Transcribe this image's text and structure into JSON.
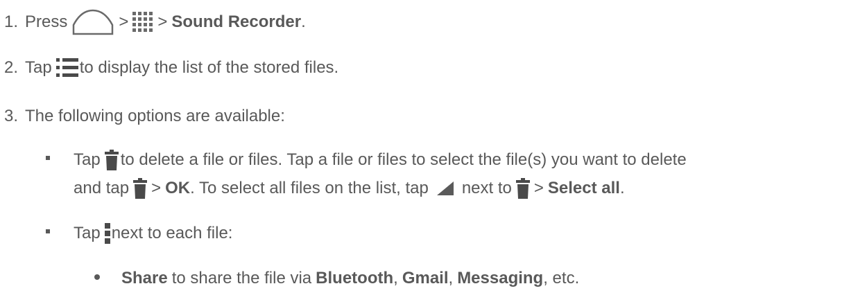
{
  "steps": [
    {
      "number": "1.",
      "press": "Press",
      "gt1": ">",
      "gt2": ">",
      "sound_recorder": "Sound Recorder",
      "period": "."
    },
    {
      "number": "2.",
      "tap": "Tap",
      "rest": "to display the list of the stored files."
    },
    {
      "number": "3.",
      "text": "The following options are available:"
    }
  ],
  "bullet_delete": {
    "tap": "Tap",
    "line1_rest": "to delete a file or files. Tap a file or files to select the file(s) you want to delete",
    "line2_a": "and tap",
    "gt1": ">",
    "ok": "OK",
    "line2_b": ". To select all files on the list, tap",
    "next_to": "next to",
    "gt2": ">",
    "select_all": "Select all",
    "period": "."
  },
  "bullet_menu": {
    "tap": "Tap",
    "rest": "next to each file:"
  },
  "sub_share": {
    "share": "Share",
    "t1": "to share the file via",
    "bluetooth": "Bluetooth",
    "comma1": ",",
    "gmail": "Gmail",
    "comma2": ",",
    "messaging": "Messaging",
    "t2": ", etc."
  },
  "icons": {
    "home": "home-icon",
    "apps": "apps-grid-icon",
    "list": "list-icon",
    "delete": "trash-icon",
    "dropdown": "dropdown-corner-icon",
    "menu": "menu-icon"
  }
}
